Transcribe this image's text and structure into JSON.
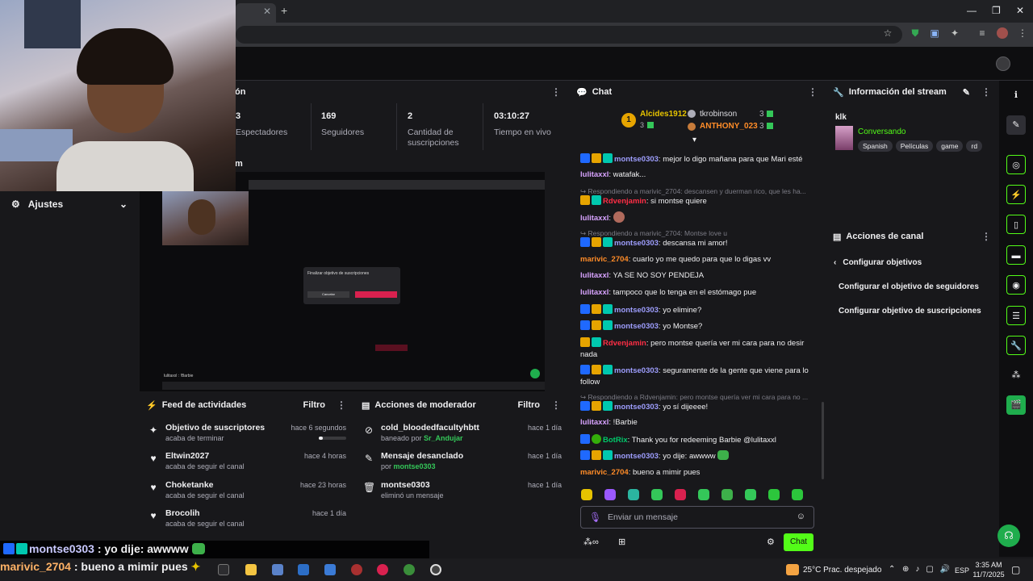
{
  "stats": {
    "panel_title_fragment": "ión",
    "items": [
      {
        "num": "3",
        "label": "Espectadores"
      },
      {
        "num": "169",
        "label": "Seguidores"
      },
      {
        "num": "2",
        "label": "Cantidad de suscripciones"
      },
      {
        "num": "03:10:27",
        "label": "Tiempo en vivo"
      }
    ]
  },
  "preview": {
    "title_fragment": "m",
    "dialog_title": "Finalizar objetivo de suscripciones",
    "dialog_cancel": "Cancelar",
    "overlay_user": "lulitaxxl : !Barbie"
  },
  "ajustes": {
    "label": "Ajustes"
  },
  "activity_feed": {
    "title": "Feed de actividades",
    "filter": "Filtro",
    "items": [
      {
        "title": "Objetivo de suscriptores",
        "sub": "acaba de terminar",
        "time": "hace 6 segundos",
        "progress": 0.15
      },
      {
        "title": "Eltwin2027",
        "sub": "acaba de seguir el canal",
        "time": "hace 4 horas"
      },
      {
        "title": "Choketanke",
        "sub": "acaba de seguir el canal",
        "time": "hace 23 horas"
      },
      {
        "title": "Brocolih",
        "sub": "acaba de seguir el canal",
        "time": "hace 1 día"
      }
    ]
  },
  "mod_actions": {
    "title": "Acciones de moderador",
    "filter": "Filtro",
    "items": [
      {
        "title": "cold_bloodedfacultyhbtt",
        "sub_pre": "baneado por ",
        "sub_user": "Sr_Andujar",
        "time": "hace 1 día"
      },
      {
        "title": "Mensaje desanclado",
        "sub_pre": "por ",
        "sub_user": "montse0303",
        "time": "hace 1 día"
      },
      {
        "title": "montse0303",
        "sub_pre": "eliminó un mensaje",
        "sub_user": "",
        "time": "hace 1 día"
      }
    ]
  },
  "chat": {
    "title": "Chat",
    "leaderboard": {
      "first_name": "Alcides1912",
      "first_count": "3",
      "rank": "1",
      "second_name": "tkrobinson",
      "second_count": "3",
      "third_name": "ANTHONY_023",
      "third_count": "3"
    },
    "messages": [
      {
        "user": "montse0303",
        "text": ": mejor lo digo mañana para que Mari esté"
      },
      {
        "user": "lulitaxxl",
        "text": ": watafak..."
      },
      {
        "reply": "Respondiendo a marivic_2704: descansen y duerman rico, que les ha..."
      },
      {
        "user": "Rdvenjamin",
        "text": ": si montse quiere"
      },
      {
        "user": "lulitaxxl",
        "text": ":"
      },
      {
        "reply": "Respondiendo a marivic_2704: Montse love u"
      },
      {
        "user": "montse0303",
        "text": ": descansa mi amor!"
      },
      {
        "user": "marivic_2704",
        "text": ": cuarlo yo me quedo para que lo digas vv"
      },
      {
        "user": "lulitaxxl",
        "text": ": YA SE NO SOY PENDEJA"
      },
      {
        "user": "lulitaxxl",
        "text": ": tampoco que lo tenga en el estómago pue"
      },
      {
        "user": "montse0303",
        "text": ": yo elimine?"
      },
      {
        "user": "montse0303",
        "text": ": yo Montse?"
      },
      {
        "user": "Rdvenjamin",
        "text": ": pero montse quería ver mi cara para no desir nada"
      },
      {
        "user": "montse0303",
        "text": ": seguramente de la gente que viene para lo follow"
      },
      {
        "reply": "Respondiendo a Rdvenjamin: pero montse quería ver mi cara para no ..."
      },
      {
        "user": "montse0303",
        "text": ": yo sí dijeeee!"
      },
      {
        "user": "lulitaxxl",
        "text": ": !Barbie"
      },
      {
        "user": "BotRix",
        "text": ": Thank you for redeeming Barbie @lulitaxxl"
      },
      {
        "user": "montse0303",
        "text": ": yo dije: awwww"
      },
      {
        "user": "marivic_2704",
        "text": ": bueno a mimir pues"
      }
    ],
    "input_placeholder": "Enviar un mensaje",
    "send_label": "Chat",
    "colors": {
      "montse": "#9e9efe",
      "lulita": "#d8a3ff",
      "rdven": "#ff2e45",
      "marivic": "#ff8c28",
      "botrix": "#00c86a"
    }
  },
  "stream_info": {
    "title": "Información del stream",
    "stream_title": "klk",
    "category": "Conversando",
    "tags": [
      "Spanish",
      "Películas",
      "game",
      "rd"
    ]
  },
  "channel_actions": {
    "title": "Acciones de canal",
    "back_label": "Configurar objetivos",
    "options": [
      "Configurar el objetivo de seguidores",
      "Configurar objetivo de suscripciones"
    ]
  },
  "overlay": {
    "line1_user": "montse0303",
    "line1_text": " : yo dije: awwww",
    "line2_user": "marivic_2704",
    "line2_text": " : bueno a mimir pues"
  },
  "taskbar": {
    "weather": "25°C  Prac. despejado",
    "lang": "ESP",
    "time": "3:35 AM",
    "date": "11/7/2025"
  }
}
